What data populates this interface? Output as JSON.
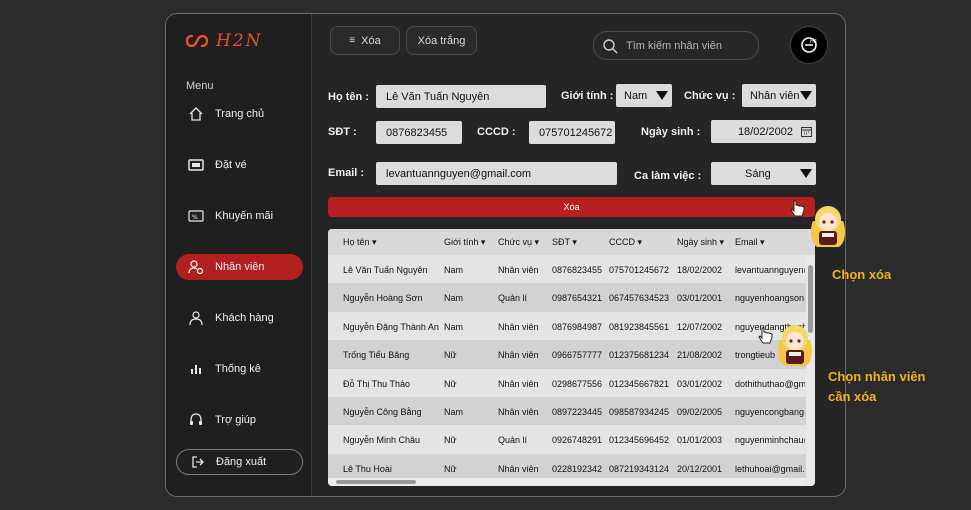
{
  "brand": {
    "name": "H2N"
  },
  "sidebar": {
    "menu_title": "Menu",
    "items": [
      {
        "label": "Trang chủ",
        "icon": "home-icon"
      },
      {
        "label": "Đặt vé",
        "icon": "ticket-icon"
      },
      {
        "label": "Khuyến mãi",
        "icon": "discount-icon"
      },
      {
        "label": "Nhân viên",
        "icon": "employee-icon",
        "active": true
      },
      {
        "label": "Khách hàng",
        "icon": "customer-icon"
      },
      {
        "label": "Thống kê",
        "icon": "chart-icon"
      },
      {
        "label": "Trợ giúp",
        "icon": "headset-icon"
      }
    ],
    "logout": "Đăng xuất"
  },
  "toolbar": {
    "delete_label": "Xóa",
    "clear_label": "Xóa trắng",
    "search_placeholder": "Tìm kiếm nhân viên"
  },
  "form": {
    "name_label": "Họ tên :",
    "name_value": "Lê Văn Tuấn Nguyên",
    "gender_label": "Giới tính :",
    "gender_value": "Nam",
    "role_label": "Chức vụ :",
    "role_value": "Nhân viên",
    "phone_label": "SĐT :",
    "phone_value": "0876823455",
    "id_label": "CCCD :",
    "id_value": "075701245672",
    "dob_label": "Ngày sinh :",
    "dob_value": "18/02/2002",
    "email_label": "Email :",
    "email_value": "levantuannguyen@gmail.com",
    "shift_label": "Ca làm việc :",
    "shift_value": "Sáng"
  },
  "delete_bar_label": "Xóa",
  "table": {
    "columns": [
      "Họ tên ▾",
      "Giới tính ▾",
      "Chức vụ ▾",
      "SĐT ▾",
      "CCCD ▾",
      "Ngày sinh ▾",
      "Email ▾"
    ],
    "rows": [
      [
        "Lê Văn Tuấn Nguyên",
        "Nam",
        "Nhân viên",
        "0876823455",
        "075701245672",
        "18/02/2002",
        "levantuannguyen@"
      ],
      [
        "Nguyễn Hoàng Sơn",
        "Nam",
        "Quản lí",
        "0987654321",
        "067457634523",
        "03/01/2001",
        "nguyenhoangson@"
      ],
      [
        "Nguyễn Đặng Thành An",
        "Nam",
        "Nhân viên",
        "0876984987",
        "081923845561",
        "12/07/2002",
        "nguyendangthanh"
      ],
      [
        "Trống Tiểu Băng",
        "Nữ",
        "Nhân viên",
        "0966757777",
        "012375681234",
        "21/08/2002",
        "trongtieub"
      ],
      [
        "Đỗ Thị Thu Thảo",
        "Nữ",
        "Nhân viên",
        "0298677556",
        "012345667821",
        "03/01/2002",
        "dothithuthao@gma"
      ],
      [
        "Nguyễn Công Bằng",
        "Nam",
        "Nhân viên",
        "0897223445",
        "098587934245",
        "09/02/2005",
        "nguyencongbang@"
      ],
      [
        "Nguyễn Minh Châu",
        "Nữ",
        "Quản lí",
        "0926748291",
        "012345696452",
        "01/01/2003",
        "nguyenminhchau@"
      ],
      [
        "Lê Thu Hoài",
        "Nữ",
        "Nhân viên",
        "0228192342",
        "087219343124",
        "20/12/2001",
        "lethuhoai@gmail.co"
      ]
    ]
  },
  "annotations": {
    "choose_delete": "Chọn xóa",
    "choose_employee_line1": "Chọn nhân viên",
    "choose_employee_line2": "cần xóa"
  },
  "colors": {
    "accent": "#b81f1f",
    "brand": "#e5532b",
    "callout": "#f2b21b"
  }
}
